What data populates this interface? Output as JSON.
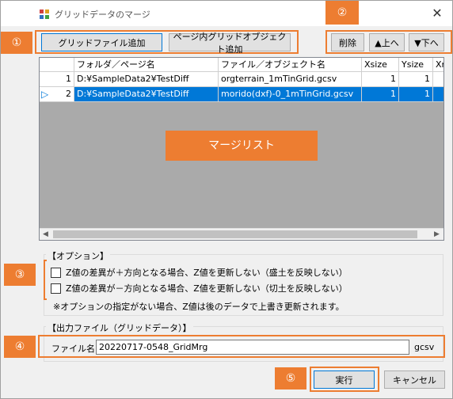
{
  "window": {
    "title": "グリッドデータのマージ",
    "close_glyph": "✕"
  },
  "toolbar": {
    "add_grid_file": "グリッドファイル追加",
    "add_page_grid_object": "ページ内グリッドオブジェクト追加",
    "delete": "削除",
    "move_up": "▲上へ",
    "move_down": "▼下へ"
  },
  "badges": {
    "b1": "①",
    "b2": "②",
    "b3": "③",
    "b4": "④",
    "b5": "⑤"
  },
  "grid": {
    "columns": [
      "",
      "フォルダ／ページ名",
      "ファイル／オブジェクト名",
      "Xsize",
      "Ysize",
      "Xr"
    ],
    "rows": [
      {
        "num": "1",
        "folder": "D:¥SampleData2¥TestDiff",
        "file": "orgterrain_1mTinGrid.gcsv",
        "xsize": "1",
        "ysize": "1",
        "selected": false
      },
      {
        "num": "2",
        "folder": "D:¥SampleData2¥TestDiff",
        "file": "morido(dxf)-0_1mTinGrid.gcsv",
        "xsize": "1",
        "ysize": "1",
        "selected": true
      }
    ],
    "selected_marker": "▷",
    "overlay_label": "マージリスト",
    "scroll_left": "◀",
    "scroll_right": "▶"
  },
  "options": {
    "title": "【オプション】",
    "opt1": "Z値の差異が＋方向となる場合、Z値を更新しない（盛土を反映しない）",
    "opt2": "Z値の差異が－方向となる場合、Z値を更新しない（切土を反映しない）",
    "note": "※オプションの指定がない場合、Z値は後のデータで上書き更新されます。"
  },
  "output": {
    "title": "【出力ファイル（グリッドデータ）】",
    "filename_label": "ファイル名:",
    "filename_value": "20220717-0548_GridMrg",
    "extension": "gcsv"
  },
  "footer": {
    "execute": "実行",
    "cancel": "キャンセル"
  },
  "colors": {
    "accent": "#ed7d31",
    "selection": "#0078d7"
  }
}
